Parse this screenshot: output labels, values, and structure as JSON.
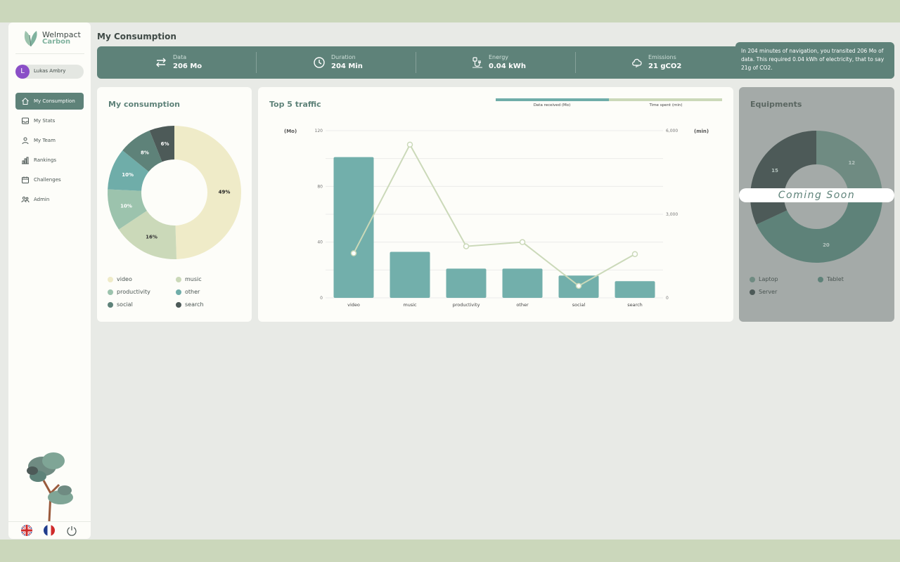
{
  "app": {
    "logo_name": "Welmpact",
    "logo_sub": "Carbon",
    "user_initial": "L",
    "user_name": "Lukas Ambry"
  },
  "nav": [
    {
      "label": "My Consumption",
      "icon": "home-icon",
      "active": true
    },
    {
      "label": "My Stats",
      "icon": "inbox-icon",
      "active": false
    },
    {
      "label": "My Team",
      "icon": "team-icon",
      "active": false
    },
    {
      "label": "Rankings",
      "icon": "rankings-icon",
      "active": false
    },
    {
      "label": "Challenges",
      "icon": "calendar-icon",
      "active": false
    },
    {
      "label": "Admin",
      "icon": "admin-icon",
      "active": false
    }
  ],
  "page_title": "My Consumption",
  "stats": [
    {
      "label": "Data",
      "value": "206 Mo",
      "icon": "transfer-arrows-icon"
    },
    {
      "label": "Duration",
      "value": "204 Min",
      "icon": "clock-icon"
    },
    {
      "label": "Energy",
      "value": "0.04 kWh",
      "icon": "energy-plug-icon"
    },
    {
      "label": "Emissions",
      "value": "21 gCO2",
      "icon": "cloud-icon"
    }
  ],
  "info_text": "In 204 minutes of navigation, you transited 206 Mo of data. This required 0.04 kWh of electricity, that to say 21g of CO2.",
  "colors": {
    "primary": "#5e8279",
    "video": "#efebc8",
    "music": "#cbd9b9",
    "productivity": "#9cc3ad",
    "other": "#6fada9",
    "social": "#5e8279",
    "search": "#4d5a58"
  },
  "consumption": {
    "title": "My consumption",
    "legend": [
      {
        "label": "video",
        "color": "#efebc8"
      },
      {
        "label": "music",
        "color": "#cbd9b9"
      },
      {
        "label": "productivity",
        "color": "#9cc3ad"
      },
      {
        "label": "other",
        "color": "#6fada9"
      },
      {
        "label": "social",
        "color": "#5e8279"
      },
      {
        "label": "search",
        "color": "#4d5a58"
      }
    ]
  },
  "traffic": {
    "title": "Top 5 traffic",
    "legend_data": "Data received (Mo)",
    "legend_time": "Time spent (min)",
    "y_left_unit": "(Mo)",
    "y_right_unit": "(min)"
  },
  "equipments": {
    "title": "Equipments",
    "coming_soon": "Coming Soon",
    "legend": [
      {
        "label": "Laptop",
        "color": "#6f8b82"
      },
      {
        "label": "Tablet",
        "color": "#5e8279"
      },
      {
        "label": "Server",
        "color": "#4d5a58"
      }
    ]
  },
  "chart_data": [
    {
      "type": "pie",
      "title": "My consumption",
      "categories": [
        "video",
        "music",
        "productivity",
        "other",
        "social",
        "search"
      ],
      "values": [
        49,
        16,
        10,
        10,
        8,
        6
      ],
      "labels": [
        "49%",
        "16%",
        "10%",
        "10%",
        "8%",
        "6%"
      ],
      "legend": "bottom"
    },
    {
      "type": "bar",
      "title": "Top 5 traffic",
      "categories": [
        "video",
        "music",
        "productivity",
        "other",
        "social",
        "search"
      ],
      "series": [
        {
          "name": "Data received (Mo)",
          "type": "bar",
          "axis": "left",
          "values": [
            101,
            33,
            21,
            21,
            16,
            12
          ]
        },
        {
          "name": "Time spent (min)",
          "type": "line",
          "axis": "right",
          "values": [
            1600,
            5500,
            1850,
            2000,
            430,
            1570
          ]
        }
      ],
      "ylabel_left": "(Mo)",
      "ylabel_right": "(min)",
      "ylim_left": [
        0,
        120
      ],
      "ylim_right": [
        0,
        6000
      ],
      "yticks_left": [
        "0",
        "40",
        "80",
        "120"
      ],
      "yticks_right": [
        "0",
        "3,000",
        "6,000"
      ],
      "grid": true,
      "legend": "top-right"
    },
    {
      "type": "pie",
      "title": "Equipments",
      "categories": [
        "Laptop",
        "Tablet",
        "Server"
      ],
      "values": [
        12,
        20,
        15
      ],
      "labels": [
        "12",
        "20",
        "15"
      ],
      "legend": "bottom"
    }
  ]
}
